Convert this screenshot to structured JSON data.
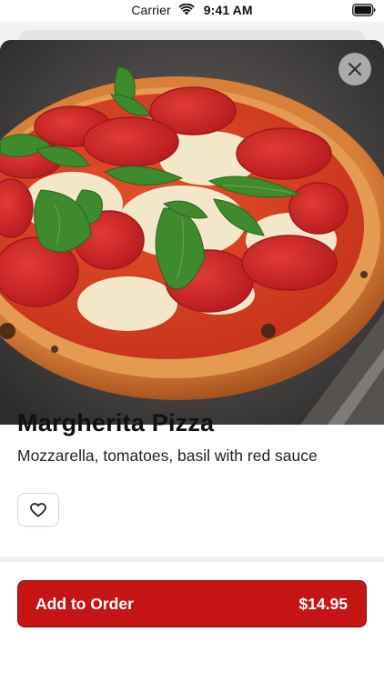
{
  "status_bar": {
    "carrier": "Carrier",
    "time": "9:41 AM"
  },
  "product": {
    "name": "Margherita Pizza",
    "description": "Mozzarella, tomatoes, basil with red sauce",
    "image_subject": "margherita pizza with pepperoni and basil on a metal pan"
  },
  "actions": {
    "add_label": "Add to Order",
    "price": "$14.95"
  },
  "icons": {
    "close": "close-icon",
    "favorite": "heart-icon",
    "wifi": "wifi-icon",
    "battery": "battery-icon"
  },
  "colors": {
    "accent": "#c51414",
    "accent_border": "#8e0b0b",
    "text_primary": "#111111"
  }
}
